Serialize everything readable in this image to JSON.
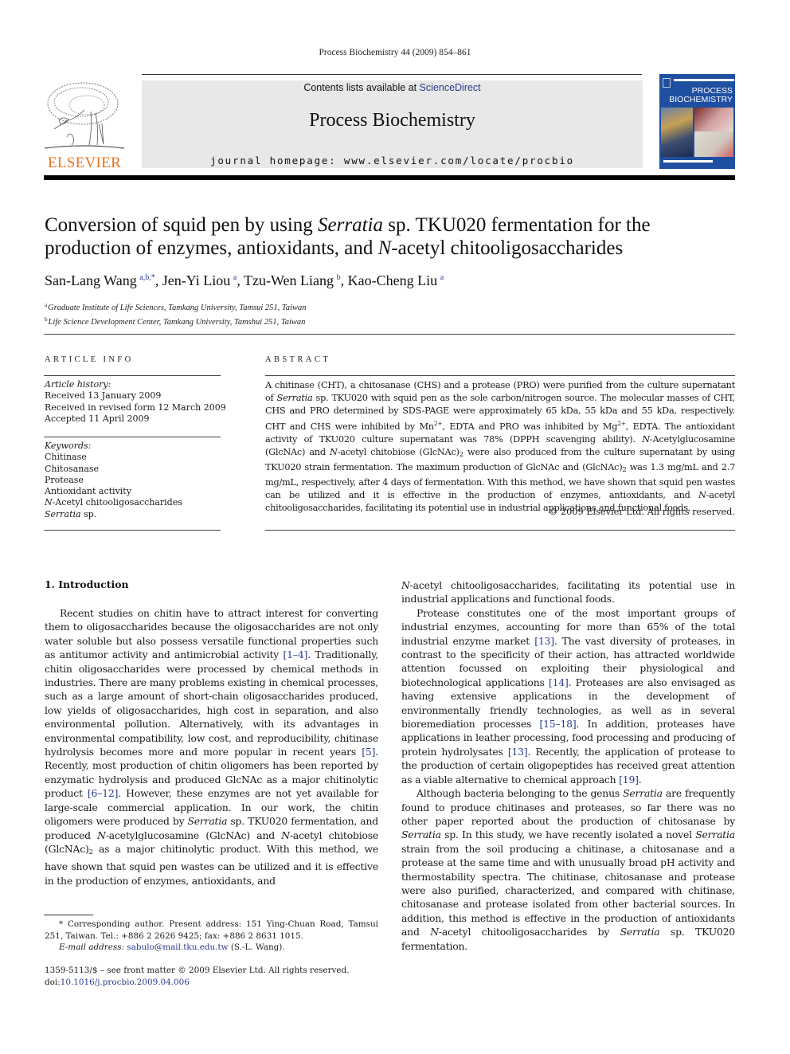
{
  "header": {
    "citation": "Process Biochemistry 44 (2009) 854–861",
    "contents_prefix": "Contents lists available at ",
    "contents_link": "ScienceDirect",
    "journal_title": "Process Biochemistry",
    "homepage": "journal homepage: www.elsevier.com/locate/procbio",
    "publisher_logo": "ELSEVIER",
    "cover_title_1": "PROCESS",
    "cover_title_2": "BIOCHEMISTRY",
    "colors": {
      "elsevier_orange": "#e8731d",
      "link_blue": "#2a3a8f",
      "cover_blue": "#1e4fa0",
      "masthead_gray": "#e8e8e8"
    }
  },
  "article": {
    "title_1": "Conversion of squid pen by using ",
    "title_italic": "Serratia",
    "title_2": " sp. TKU020 fermentation for the",
    "title_3": "production of enzymes, antioxidants, and ",
    "title_italic_2": "N",
    "title_4": "-acetyl chitooligosaccharides",
    "authors": [
      {
        "name": "San-Lang Wang",
        "marks": "a,b,*"
      },
      {
        "name": "Jen-Yi Liou",
        "marks": "a"
      },
      {
        "name": "Tzu-Wen Liang",
        "marks": "b"
      },
      {
        "name": "Kao-Cheng Liu",
        "marks": "a"
      }
    ],
    "affiliations": [
      {
        "mark": "a",
        "text": "Graduate Institute of Life Sciences, Tamkang University, Tamsui 251, Taiwan"
      },
      {
        "mark": "b",
        "text": "Life Science Development Center, Tamkang University, Tamshui 251, Taiwan"
      }
    ]
  },
  "article_info": {
    "heading": "ARTICLE INFO",
    "history_label": "Article history:",
    "history": [
      "Received 13 January 2009",
      "Received in revised form 12 March 2009",
      "Accepted 11 April 2009"
    ],
    "keywords_label": "Keywords:",
    "keywords": [
      "Chitinase",
      "Chitosanase",
      "Protease",
      "Antioxidant activity"
    ],
    "kw5_italic": "N",
    "kw5_rest": "-Acetyl chitooligosaccharides",
    "kw6_italic": "Serratia",
    "kw6_rest": " sp."
  },
  "abstract": {
    "heading": "ABSTRACT",
    "s1": "A chitinase (CHT), a chitosanase (CHS) and a protease (PRO) were purified from the culture supernatant of ",
    "s1_it": "Serratia",
    "s2": " sp. TKU020 with squid pen as the sole carbon/nitrogen source. The molecular masses of CHT, CHS and PRO determined by SDS-PAGE were approximately 65 kDa, 55 kDa and 55 kDa, respectively. CHT and CHS were inhibited by Mn",
    "sup1": "2+",
    "s3": ", EDTA and PRO was inhibited by Mg",
    "sup2": "2+",
    "s4": ", EDTA. The antioxidant activity of TKU020 culture supernatant was 78% (DPPH scavenging ability). ",
    "s4_it": "N",
    "s5": "-Acetylglucosamine (GlcNAc) and ",
    "s5_it": "N",
    "s6": "-acetyl chitobiose (GlcNAc)",
    "sub1": "2",
    "s7": " were also produced from the culture supernatant by using TKU020 strain fermentation. The maximum production of GlcNAc and (GlcNAc)",
    "sub2": "2",
    "s8": " was 1.3 mg/mL and 2.7 mg/mL, respectively, after 4 days of fermentation. With this method, we have shown that squid pen wastes can be utilized and it is effective in the production of enzymes, antioxidants, and ",
    "s8_it": "N",
    "s9": "-acetyl chitooligosaccharides, facilitating its potential use in industrial applications and functional foods.",
    "copyright": "© 2009 Elsevier Ltd. All rights reserved."
  },
  "body": {
    "intro_heading": "1.  Introduction",
    "p1a": "Recent studies on chitin have to attract interest for converting them to oligosaccharides because the oligosaccharides are not only water soluble but also possess versatile functional properties such as antitumor activity and antimicrobial activity ",
    "ref1": "[1–4]",
    "p1b": ". Traditionally, chitin oligosaccharides were processed by chemical methods in industries. There are many problems existing in chemical processes, such as a large amount of short-chain oligosaccharides produced, low yields of oligosaccharides, high cost in separation, and also environmental pollution. Alternatively, with its advantages in environmental compatibility, low cost, and reproducibility, chitinase hydrolysis becomes more and more popular in recent years ",
    "ref2": "[5]",
    "p1c": ". Recently, most production of chitin oligomers has been reported by enzymatic hydrolysis and produced GlcNAc as a major chitinolytic product ",
    "ref3": "[6–12]",
    "p1d": ". However, these enzymes are not yet available for large-scale commercial application. In our work, the chitin oligomers were produced by ",
    "p1d_it": "Serratia",
    "p1e": " sp. TKU020 fermentation, and produced ",
    "p1e_it": "N",
    "p1f": "-acetylglucosamine (GlcNAc) and ",
    "p1f_it": "N",
    "p1g": "-acetyl chitobiose (GlcNAc)",
    "p1g_sub": "2",
    "p1h": " as a major chitinolytic product. With this method, we have shown that squid pen wastes can be utilized and it is effective in the production of enzymes, antioxidants, and",
    "r0_it": "N",
    "r0": "-acetyl chitooligosaccharides, facilitating its potential use in industrial applications and functional foods.",
    "p2a": "Protease constitutes one of the most important groups of industrial enzymes, accounting for more than 65% of the total industrial enzyme market ",
    "ref4": "[13]",
    "p2b": ". The vast diversity of proteases, in contrast to the specificity of their action, has attracted worldwide attention focussed on exploiting their physiological and biotechnological applications ",
    "ref5": "[14]",
    "p2c": ". Proteases are also envisaged as having extensive applications in the development of environmentally friendly technologies, as well as in several bioremediation processes ",
    "ref6": "[15–18]",
    "p2d": ". In addition, proteases have applications in leather processing, food processing and producing of protein hydrolysates ",
    "ref7": "[13]",
    "p2e": ". Recently, the application of protease to the production of certain oligopeptides has received great attention as a viable alternative to chemical approach ",
    "ref8": "[19]",
    "p2f": ".",
    "p3a": "Although bacteria belonging to the genus ",
    "p3a_it": "Serratia",
    "p3b": " are frequently found to produce chitinases and proteases, so far there was no other paper reported about the production of chitosanase by ",
    "p3b_it": "Serratia",
    "p3c": " sp. In this study, we have recently isolated a novel ",
    "p3c_it": "Serratia",
    "p3d": " strain from the soil producing a chitinase, a chitosanase and a protease at the same time and with unusually broad pH activity and thermostability spectra. The chitinase, chitosanase and protease were also purified, characterized, and compared with chitinase, chitosanase and protease isolated from other bacterial sources. In addition, this method is effective in the production of antioxidants and ",
    "p3d_it": "N",
    "p3e": "-acetyl chitooligosaccharides by ",
    "p3e_it": "Serratia",
    "p3f": " sp. TKU020 fermentation."
  },
  "footnote": {
    "corresponding": "* Corresponding author. Present address: 151 Ying-Chuan Road, Tamsui 251, Taiwan. Tel.: +886 2 2626 9425; fax: +886 2 8631 1015.",
    "email_label": "E-mail address:",
    "email": "sabulo@mail.tku.edu.tw",
    "email_suffix": " (S.-L. Wang).",
    "front_matter": "1359-5113/$ – see front matter © 2009 Elsevier Ltd. All rights reserved.",
    "doi_prefix": "doi:",
    "doi": "10.1016/j.procbio.2009.04.006"
  }
}
